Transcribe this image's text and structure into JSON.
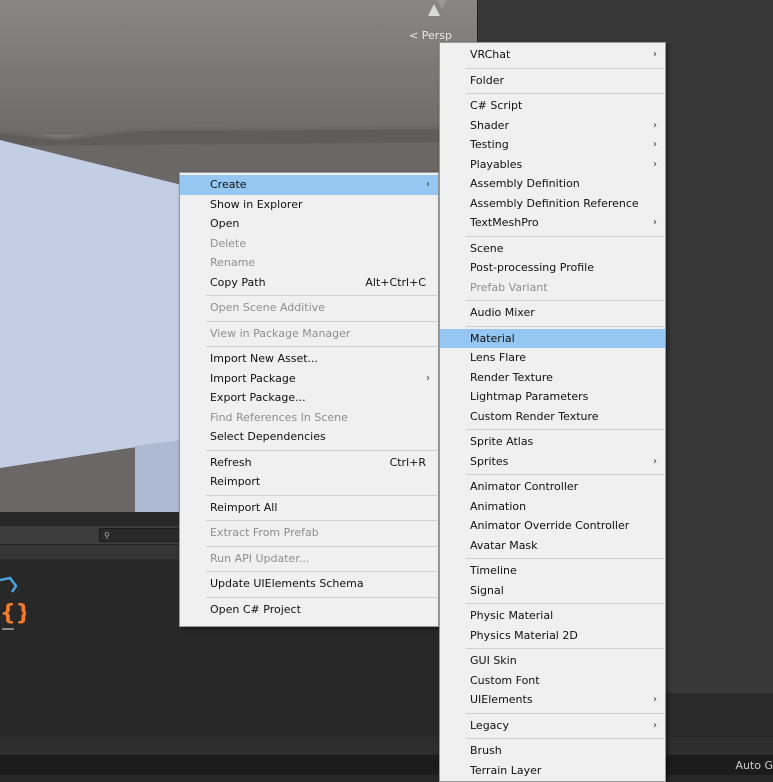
{
  "scene": {
    "persp_label": "< Persp",
    "icon": "scene-gizmo-icon"
  },
  "project_panel": {
    "search_icon": "search-icon",
    "search_glyph": "⚲"
  },
  "status": {
    "auto_text": "Auto G"
  },
  "colors": {
    "menu_bg": "#f0f0f0",
    "highlight": "#96c7f2",
    "disabled": "#8e8e8e"
  },
  "context_menu": [
    {
      "label": "Create",
      "arrow": true,
      "highlight": true
    },
    {
      "label": "Show in Explorer"
    },
    {
      "label": "Open"
    },
    {
      "label": "Delete",
      "disabled": true
    },
    {
      "label": "Rename",
      "disabled": true
    },
    {
      "label": "Copy Path",
      "shortcut": "Alt+Ctrl+C"
    },
    {
      "sep": true
    },
    {
      "label": "Open Scene Additive",
      "disabled": true
    },
    {
      "sep": true
    },
    {
      "label": "View in Package Manager",
      "disabled": true
    },
    {
      "sep": true
    },
    {
      "label": "Import New Asset..."
    },
    {
      "label": "Import Package",
      "arrow": true
    },
    {
      "label": "Export Package..."
    },
    {
      "label": "Find References In Scene",
      "disabled": true
    },
    {
      "label": "Select Dependencies"
    },
    {
      "sep": true
    },
    {
      "label": "Refresh",
      "shortcut": "Ctrl+R"
    },
    {
      "label": "Reimport"
    },
    {
      "sep": true
    },
    {
      "label": "Reimport All"
    },
    {
      "sep": true
    },
    {
      "label": "Extract From Prefab",
      "disabled": true
    },
    {
      "sep": true
    },
    {
      "label": "Run API Updater...",
      "disabled": true
    },
    {
      "sep": true
    },
    {
      "label": "Update UIElements Schema"
    },
    {
      "sep": true
    },
    {
      "label": "Open C# Project"
    }
  ],
  "create_submenu": [
    {
      "label": "VRChat",
      "arrow": true
    },
    {
      "sep": true
    },
    {
      "label": "Folder"
    },
    {
      "sep": true
    },
    {
      "label": "C# Script"
    },
    {
      "label": "Shader",
      "arrow": true
    },
    {
      "label": "Testing",
      "arrow": true
    },
    {
      "label": "Playables",
      "arrow": true
    },
    {
      "label": "Assembly Definition"
    },
    {
      "label": "Assembly Definition Reference"
    },
    {
      "label": "TextMeshPro",
      "arrow": true
    },
    {
      "sep": true
    },
    {
      "label": "Scene"
    },
    {
      "label": "Post-processing Profile"
    },
    {
      "label": "Prefab Variant",
      "disabled": true
    },
    {
      "sep": true
    },
    {
      "label": "Audio Mixer"
    },
    {
      "sep": true
    },
    {
      "label": "Material",
      "highlight": true
    },
    {
      "label": "Lens Flare"
    },
    {
      "label": "Render Texture"
    },
    {
      "label": "Lightmap Parameters"
    },
    {
      "label": "Custom Render Texture"
    },
    {
      "sep": true
    },
    {
      "label": "Sprite Atlas"
    },
    {
      "label": "Sprites",
      "arrow": true
    },
    {
      "sep": true
    },
    {
      "label": "Animator Controller"
    },
    {
      "label": "Animation"
    },
    {
      "label": "Animator Override Controller"
    },
    {
      "label": "Avatar Mask"
    },
    {
      "sep": true
    },
    {
      "label": "Timeline"
    },
    {
      "label": "Signal"
    },
    {
      "sep": true
    },
    {
      "label": "Physic Material"
    },
    {
      "label": "Physics Material 2D"
    },
    {
      "sep": true
    },
    {
      "label": "GUI Skin"
    },
    {
      "label": "Custom Font"
    },
    {
      "label": "UIElements",
      "arrow": true
    },
    {
      "sep": true
    },
    {
      "label": "Legacy",
      "arrow": true
    },
    {
      "sep": true
    },
    {
      "label": "Brush"
    },
    {
      "label": "Terrain Layer"
    }
  ]
}
